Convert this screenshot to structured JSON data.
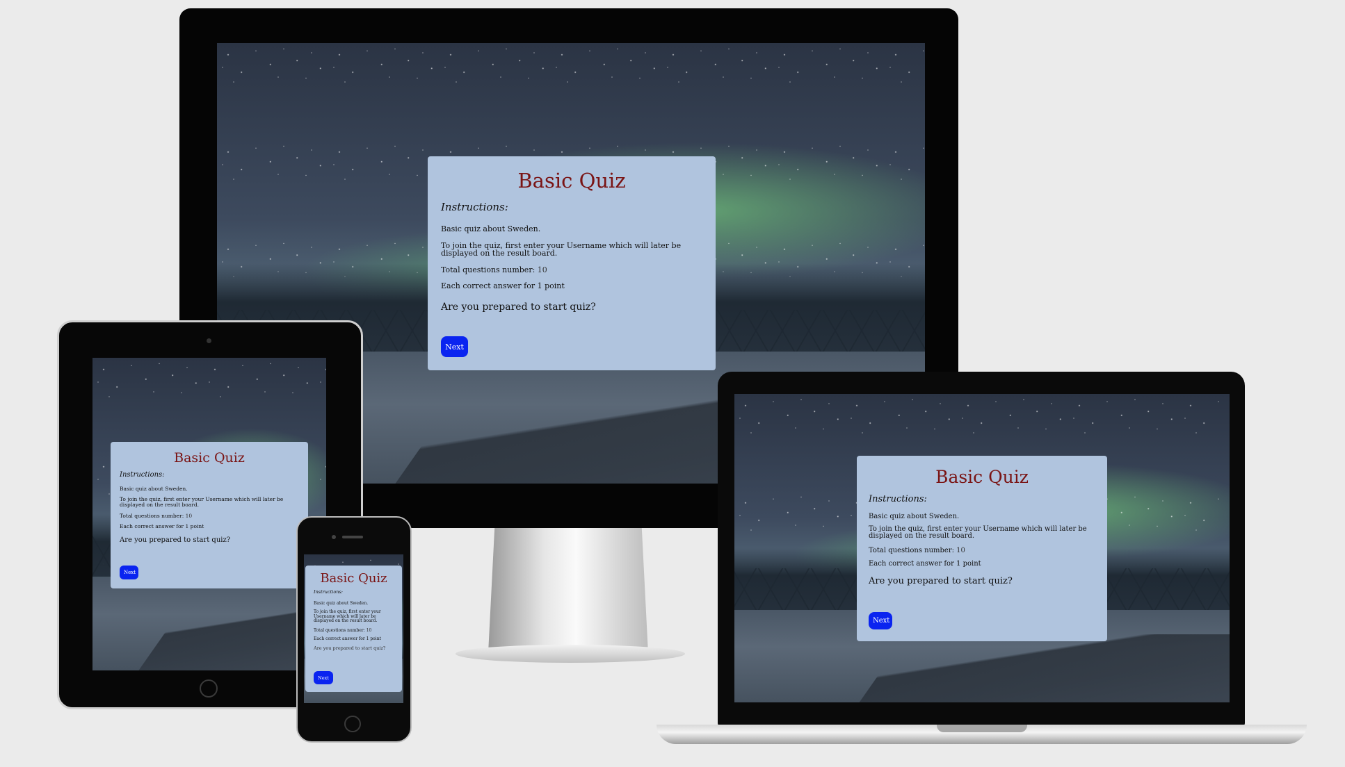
{
  "quiz": {
    "title": "Basic Quiz",
    "instructions_heading": "Instructions:",
    "line_about": "Basic quiz about Sweden.",
    "line_join": "To join the quiz, first enter your Username which will later be displayed on the result board.",
    "total_label": "Total questions number:",
    "total_value": "10",
    "line_points": "Each correct answer for 1 point",
    "question": "Are you prepared to start quiz?",
    "next_label": "Next"
  },
  "colors": {
    "card_bg": "#b0c4de",
    "title": "#7a1414",
    "button": "#0a24f0",
    "page_bg": "#ebebeb"
  }
}
